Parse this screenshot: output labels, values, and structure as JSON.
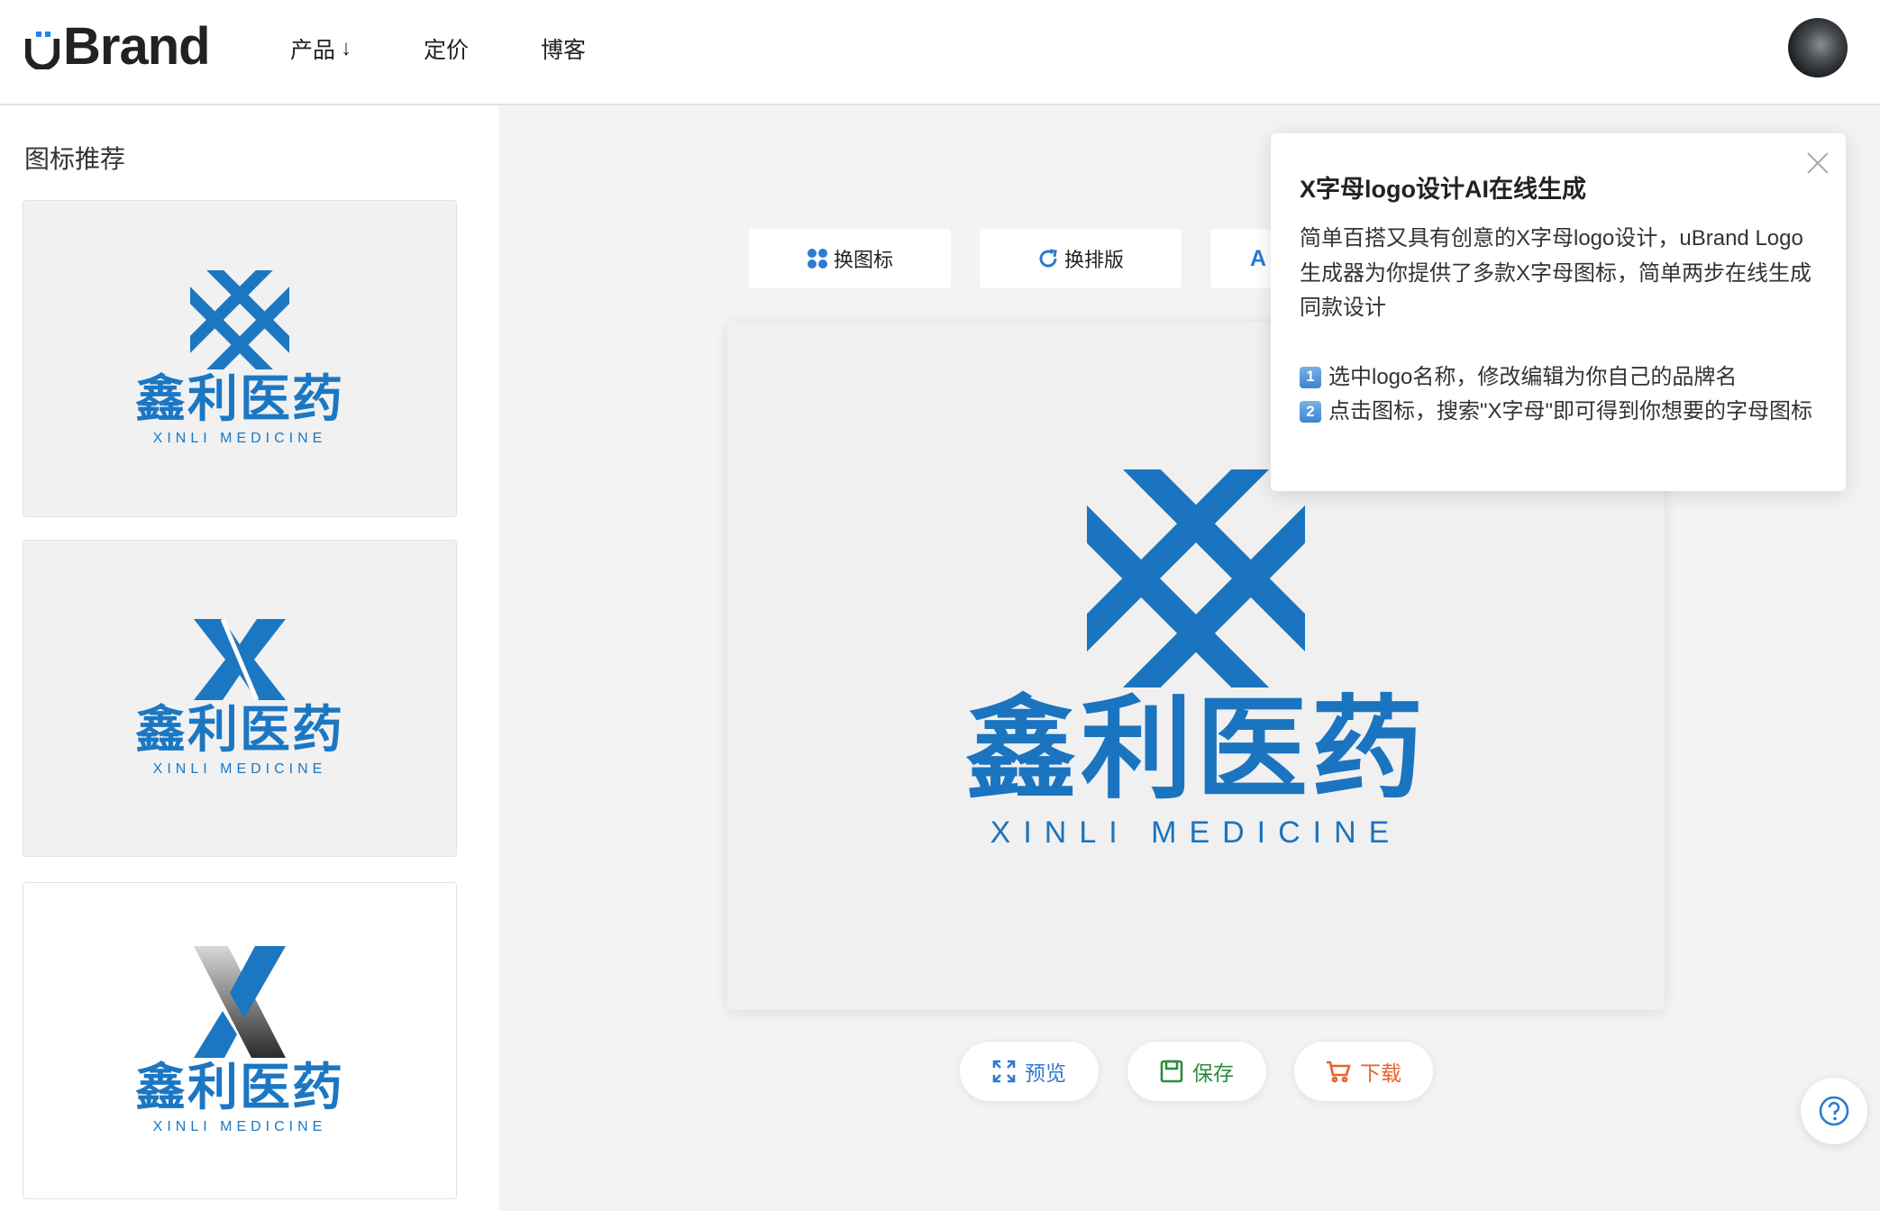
{
  "header": {
    "brand": "Brand",
    "nav": [
      {
        "label": "产品",
        "arrow": "↓"
      },
      {
        "label": "定价"
      },
      {
        "label": "博客"
      }
    ]
  },
  "sidebar": {
    "title": "图标推荐",
    "cards": [
      {
        "name": "鑫利医药",
        "sub": "XINLI MEDICINE",
        "icon": "linked-x-icon"
      },
      {
        "name": "鑫利医药",
        "sub": "XINLI MEDICINE",
        "icon": "solid-x-icon"
      },
      {
        "name": "鑫利医药",
        "sub": "XINLI MEDICINE",
        "icon": "gradient-x-icon"
      }
    ]
  },
  "toolbar": {
    "change_icon": "换图标",
    "change_layout": "换排版",
    "font_partial": "A"
  },
  "canvas": {
    "name": "鑫利医药",
    "sub": "XINLI MEDICINE"
  },
  "actions": {
    "preview": "预览",
    "save": "保存",
    "download": "下载"
  },
  "popover": {
    "title": "X字母logo设计AI在线生成",
    "intro": "简单百搭又具有创意的X字母logo设计，uBrand Logo生成器为你提供了多款X字母图标，简单两步在线生成同款设计",
    "step1_badge": "1",
    "step1": "选中logo名称，修改编辑为你自己的品牌名",
    "step2_badge": "2",
    "step2": "点击图标，搜索\"X字母\"即可得到你想要的字母图标"
  },
  "colors": {
    "brand_blue": "#1b74bf",
    "save_green": "#2e8b3e",
    "download_orange": "#e8622a",
    "preview_blue": "#2f7ad1"
  }
}
